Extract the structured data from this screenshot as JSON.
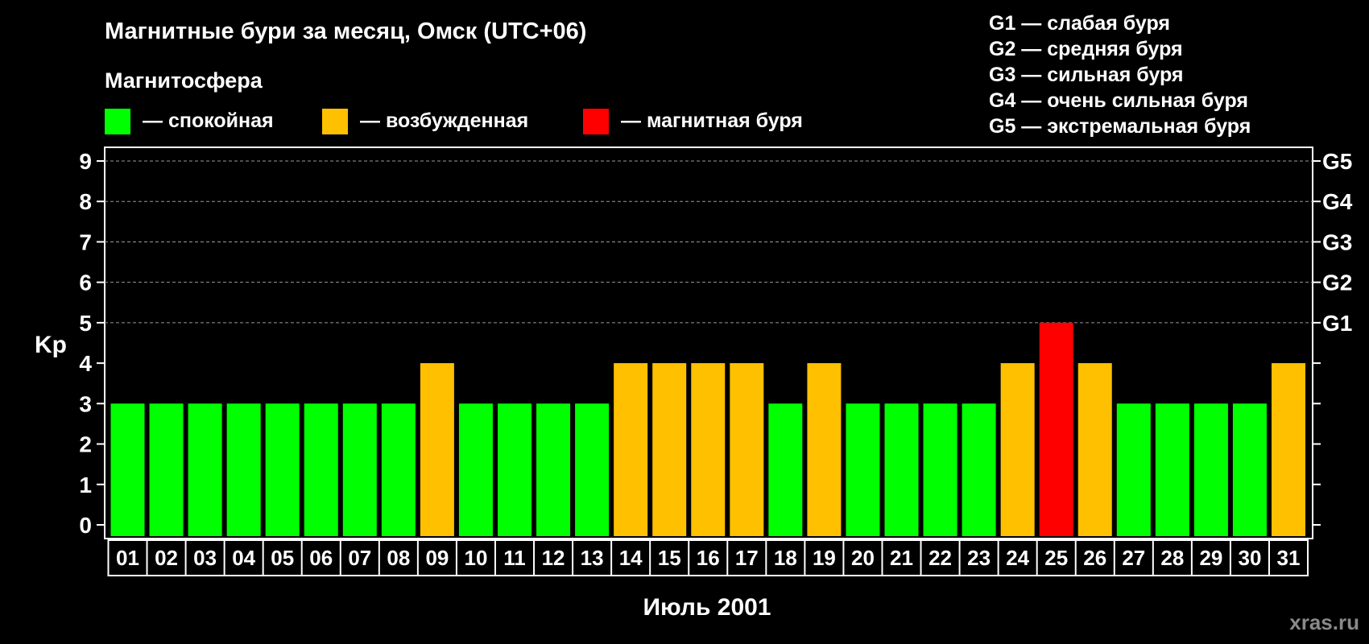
{
  "chart_data": {
    "type": "bar",
    "title": "Магнитные бури за месяц, Омск (UTC+06)",
    "subtitle": "Магнитосфера",
    "xlabel": "Июль 2001",
    "ylabel": "Kp",
    "ylim": [
      0,
      9
    ],
    "yticks": [
      "0",
      "1",
      "2",
      "3",
      "4",
      "5",
      "6",
      "7",
      "8",
      "9"
    ],
    "right_axis_labels": [
      {
        "value": 5,
        "label": "G1"
      },
      {
        "value": 6,
        "label": "G2"
      },
      {
        "value": 7,
        "label": "G3"
      },
      {
        "value": 8,
        "label": "G4"
      },
      {
        "value": 9,
        "label": "G5"
      }
    ],
    "grid": "dashed horizontal at 5-9",
    "categories": [
      "01",
      "02",
      "03",
      "04",
      "05",
      "06",
      "07",
      "08",
      "09",
      "10",
      "11",
      "12",
      "13",
      "14",
      "15",
      "16",
      "17",
      "18",
      "19",
      "20",
      "21",
      "22",
      "23",
      "24",
      "25",
      "26",
      "27",
      "28",
      "29",
      "30",
      "31"
    ],
    "values": [
      3,
      3,
      3,
      3,
      3,
      3,
      3,
      3,
      4,
      3,
      3,
      3,
      3,
      4,
      4,
      4,
      4,
      3,
      4,
      3,
      3,
      3,
      3,
      4,
      5,
      4,
      3,
      3,
      3,
      3,
      4
    ],
    "legend": [
      {
        "label": "— спокойная",
        "color": "#00ff00"
      },
      {
        "label": "— возбужденная",
        "color": "#ffc000"
      },
      {
        "label": "— магнитная буря",
        "color": "#ff0000"
      }
    ],
    "storm_levels": [
      "G1 — слабая буря",
      "G2 — средняя буря",
      "G3 — сильная буря",
      "G4 — очень сильная буря",
      "G5 — экстремальная буря"
    ],
    "colors": {
      "quiet": "#00ff00",
      "disturbed": "#ffc000",
      "storm": "#ff0000",
      "background": "#000000",
      "frame": "#ffffff"
    }
  },
  "watermark": "xras.ru"
}
